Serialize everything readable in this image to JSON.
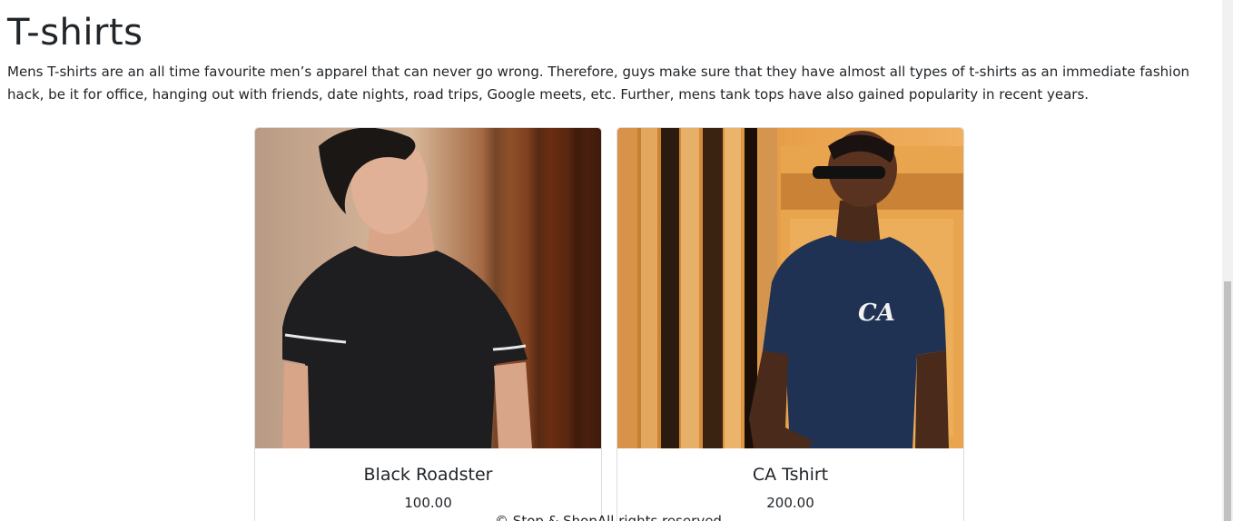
{
  "page": {
    "title": "T-shirts",
    "description": "Mens T-shirts are an all time favourite men’s apparel that can never go wrong. Therefore, guys make sure that they have almost all types of t-shirts as an immediate fashion hack, be it for office, hanging out with friends, date nights, road trips, Google meets, etc. Further, mens tank tops have also gained popularity in recent years."
  },
  "products": [
    {
      "name": "Black Roadster",
      "price": "100.00",
      "image_icon": "photo-man-black-tshirt"
    },
    {
      "name": "CA Tshirt",
      "price": "200.00",
      "image_icon": "photo-man-navy-tshirt",
      "shirt_print": "CA"
    }
  ],
  "footer": {
    "text": "© Stop & ShopAll rights reserved"
  },
  "colors": {
    "text": "#212529",
    "card_border": "#dcdcdc",
    "scrollbar_track": "#f1f1f1",
    "scrollbar_thumb": "#c1c1c1"
  }
}
